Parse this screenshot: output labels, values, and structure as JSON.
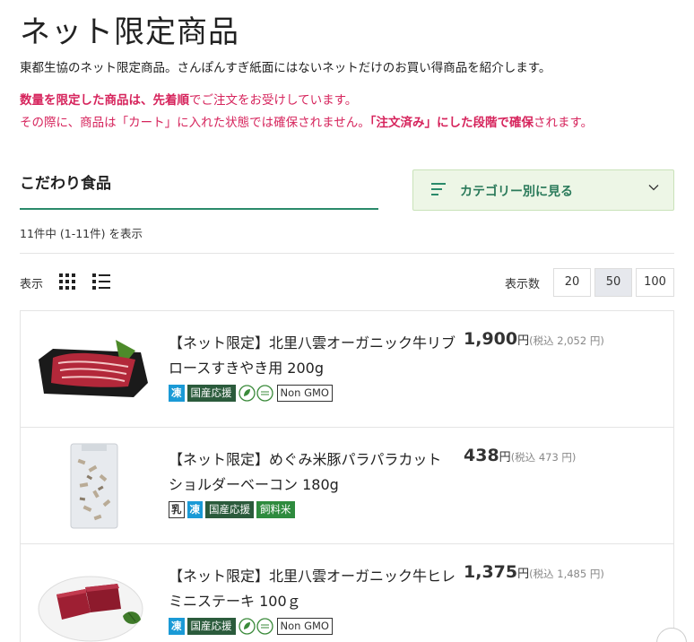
{
  "page": {
    "title": "ネット限定商品",
    "intro": "東都生協のネット限定商品。さんぽんすぎ紙面にはないネットだけのお買い得商品を紹介します。",
    "notice_line1_bold": "数量を限定した商品は、先着順",
    "notice_line1_rest": "でご注文をお受けしています。",
    "notice_line2_a": "その際に、商品は「カート」に入れた状態では確保されません。",
    "notice_line2_bold": "「注文済み」にした段階で確保",
    "notice_line2_b": "されます。"
  },
  "section": {
    "title": "こだわり食品",
    "category_button": "カテゴリー別に見る",
    "count_text": "11件中 (1-11件) を表示"
  },
  "toolbar": {
    "view_label": "表示",
    "per_page_label": "表示数",
    "per_page_options": [
      "20",
      "50",
      "100"
    ],
    "per_page_selected": "50"
  },
  "products": [
    {
      "name": "【ネット限定】北里八雲オーガニック牛リブロースすきやき用 200g",
      "price": "1,900",
      "yen": "円",
      "tax": "(税込 2,052 円)",
      "badges": [
        "凍",
        "国産応援",
        "JAS",
        "Non GMO"
      ]
    },
    {
      "name": "【ネット限定】めぐみ米豚パラパラカットショルダーベーコン 180g",
      "price": "438",
      "yen": "円",
      "tax": "(税込 473 円)",
      "badges": [
        "乳",
        "凍",
        "国産応援",
        "飼料米"
      ]
    },
    {
      "name": "【ネット限定】北里八雲オーガニック牛ヒレミニステーキ 100ｇ",
      "price": "1,375",
      "yen": "円",
      "tax": "(税込 1,485 円)",
      "badges": [
        "凍",
        "国産応援",
        "JAS",
        "Non GMO"
      ]
    }
  ],
  "colors": {
    "accent_green": "#2a8a6a",
    "notice_red": "#d6245c",
    "frozen_blue": "#1a9ad6",
    "domestic_green": "#2b5b3c"
  }
}
